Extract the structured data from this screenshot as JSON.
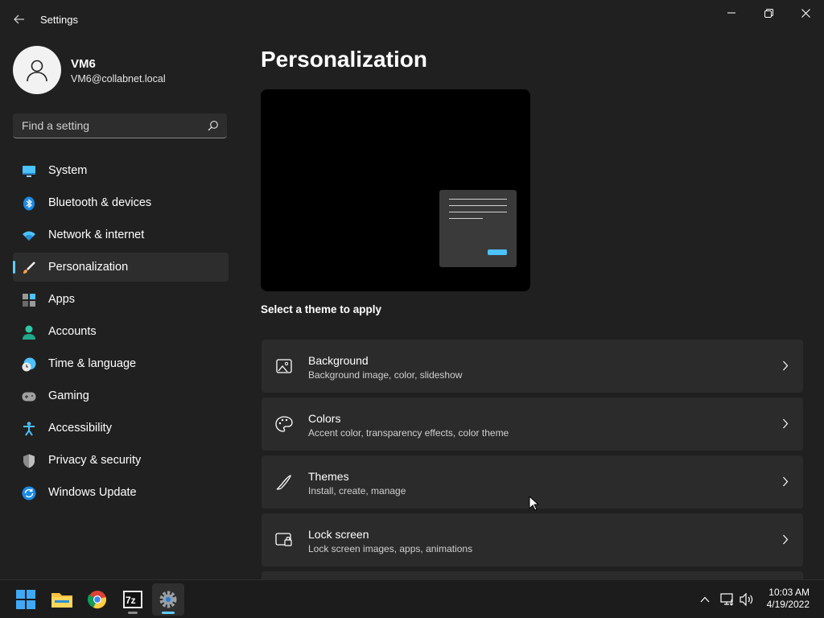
{
  "window": {
    "title": "Settings"
  },
  "user": {
    "name": "VM6",
    "email": "VM6@collabnet.local"
  },
  "search": {
    "placeholder": "Find a setting"
  },
  "nav": {
    "items": [
      {
        "label": "System",
        "icon": "monitor-icon"
      },
      {
        "label": "Bluetooth & devices",
        "icon": "bluetooth-icon"
      },
      {
        "label": "Network & internet",
        "icon": "wifi-icon"
      },
      {
        "label": "Personalization",
        "icon": "brush-icon",
        "active": true
      },
      {
        "label": "Apps",
        "icon": "apps-icon"
      },
      {
        "label": "Accounts",
        "icon": "accounts-icon"
      },
      {
        "label": "Time & language",
        "icon": "clock-globe-icon"
      },
      {
        "label": "Gaming",
        "icon": "gamepad-icon"
      },
      {
        "label": "Accessibility",
        "icon": "accessibility-icon"
      },
      {
        "label": "Privacy & security",
        "icon": "shield-icon"
      },
      {
        "label": "Windows Update",
        "icon": "update-icon"
      }
    ]
  },
  "main": {
    "title": "Personalization",
    "theme_section_label": "Select a theme to apply",
    "cards": [
      {
        "title": "Background",
        "subtitle": "Background image, color, slideshow",
        "icon": "image-icon"
      },
      {
        "title": "Colors",
        "subtitle": "Accent color, transparency effects, color theme",
        "icon": "palette-icon"
      },
      {
        "title": "Themes",
        "subtitle": "Install, create, manage",
        "icon": "pen-icon"
      },
      {
        "title": "Lock screen",
        "subtitle": "Lock screen images, apps, animations",
        "icon": "lock-screen-icon"
      }
    ]
  },
  "taskbar": {
    "apps": [
      "windows-start-icon",
      "file-explorer-icon",
      "chrome-icon",
      "7zip-icon",
      "settings-icon"
    ],
    "time": "10:03 AM",
    "date": "4/19/2022"
  },
  "colors": {
    "accent": "#60cdff",
    "background": "#202020",
    "card": "#2b2b2b"
  }
}
